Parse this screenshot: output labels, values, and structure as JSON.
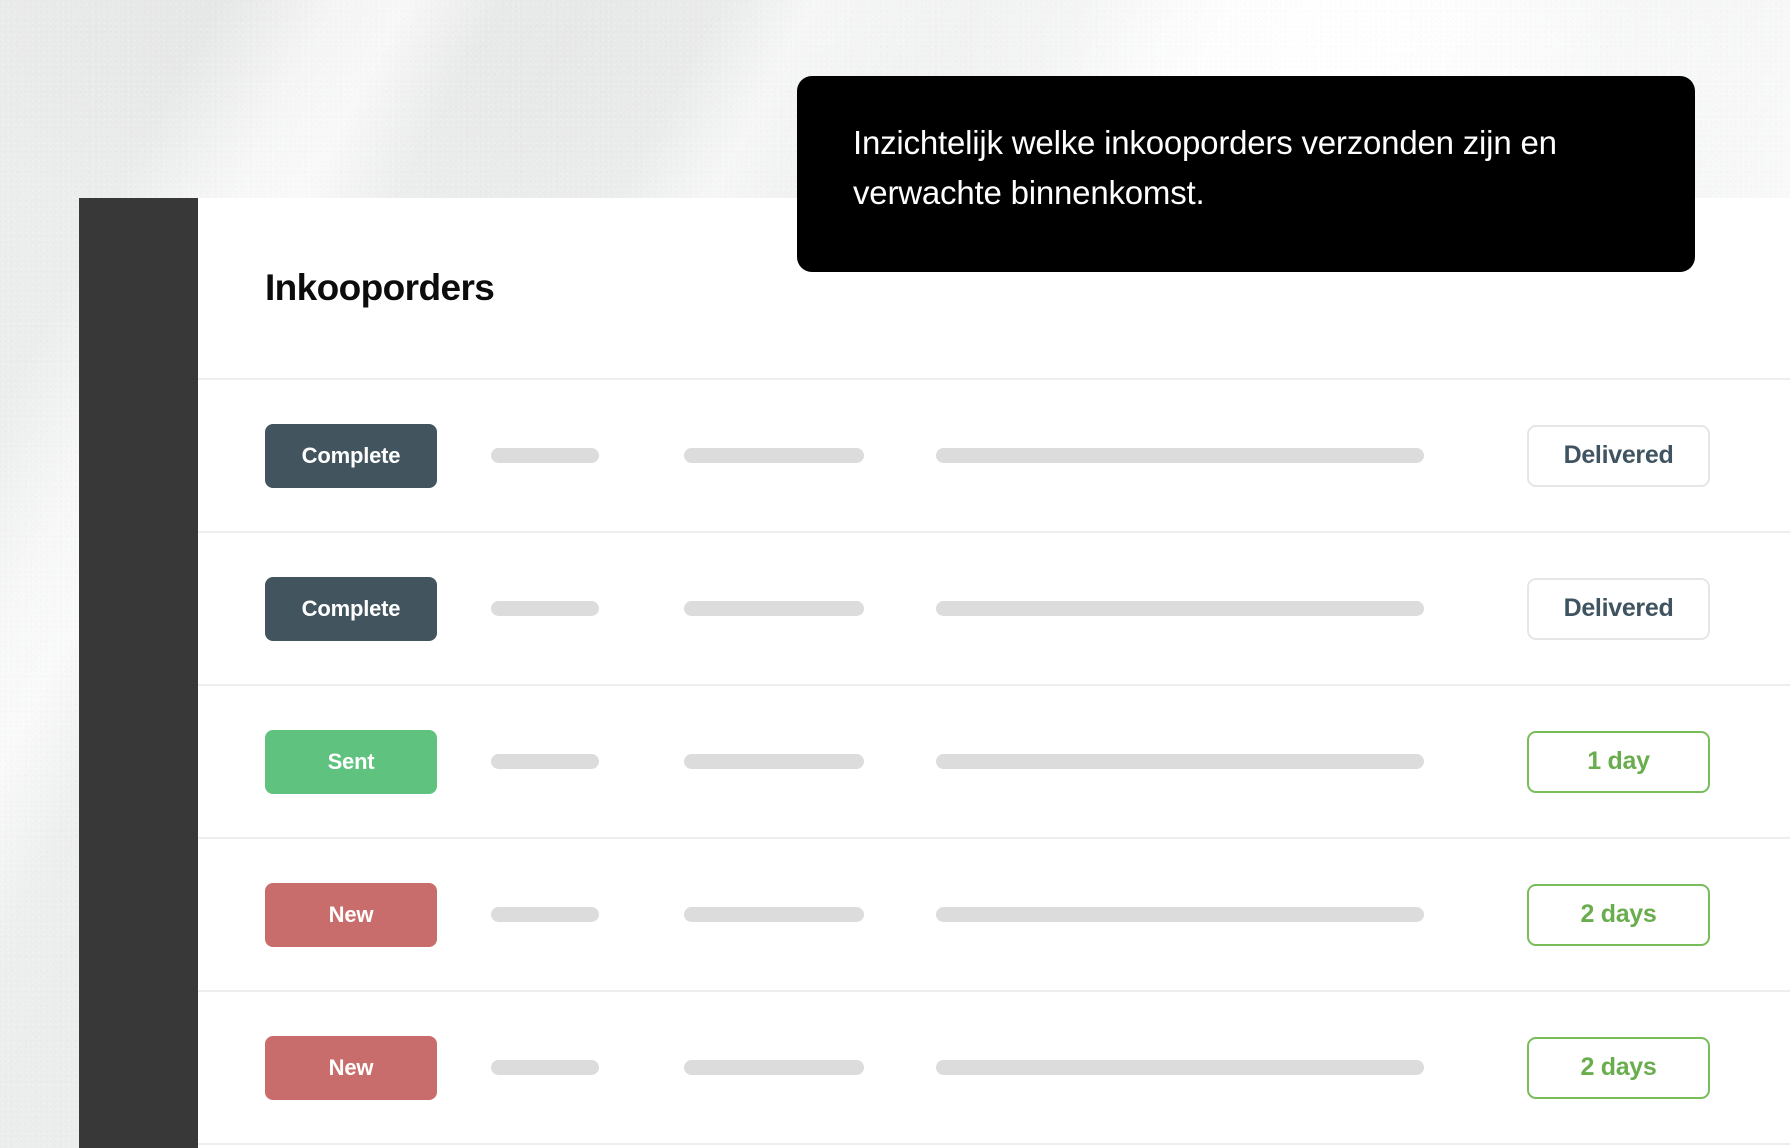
{
  "background": {
    "wall_color": "#eceded",
    "rail_color": "#383838",
    "card_color": "#ffffff"
  },
  "tooltip": {
    "text": "Inzichtelijk welke inkooporders verzonden zijn en verwachte binnenkomst.",
    "background_color": "#000000",
    "text_color": "#ffffff"
  },
  "header": {
    "title": "Inkooporders"
  },
  "colors": {
    "badge_complete": "#42555f",
    "badge_sent": "#5fc27e",
    "badge_new": "#c96c6c",
    "pill_neutral_text": "#3f5460",
    "pill_due_border": "#79bc5a",
    "pill_due_text": "#6aad4e",
    "skeleton": "#dcdcdc",
    "divider": "#eeeeee"
  },
  "table": {
    "rows": [
      {
        "status": "Complete",
        "status_kind": "complete",
        "eta": "Delivered",
        "eta_kind": "neutral"
      },
      {
        "status": "Complete",
        "status_kind": "complete",
        "eta": "Delivered",
        "eta_kind": "neutral"
      },
      {
        "status": "Sent",
        "status_kind": "sent",
        "eta": "1 day",
        "eta_kind": "due"
      },
      {
        "status": "New",
        "status_kind": "new",
        "eta": "2 days",
        "eta_kind": "due"
      },
      {
        "status": "New",
        "status_kind": "new",
        "eta": "2 days",
        "eta_kind": "due"
      }
    ]
  }
}
